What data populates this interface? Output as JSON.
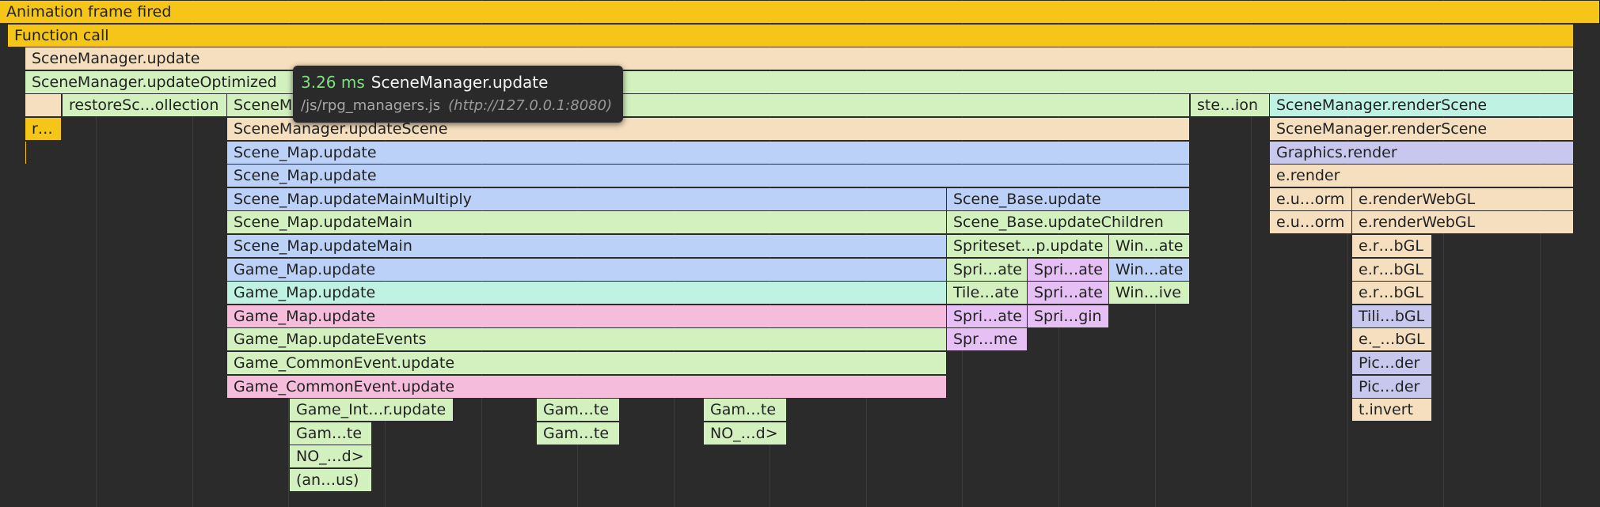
{
  "colors": {
    "yellow": "#f5c518",
    "peach": "#f5dfbf",
    "green": "#d3f0bf",
    "mint": "#c0f2e4",
    "blue": "#bcd1f8",
    "pink": "#f5bddb",
    "violet": "#e6bff5",
    "lavender": "#c8c8ef"
  },
  "tooltip": {
    "duration": "3.26 ms",
    "function": "SceneManager.update",
    "file": "/js/rpg_managers.js",
    "url": "(http://127.0.0.1:8080)"
  },
  "frames": [
    {
      "label": "Animation frame fired",
      "color": "yellow"
    },
    {
      "label": "Function call",
      "color": "yellow"
    },
    {
      "label": "SceneManager.update",
      "color": "peach"
    },
    {
      "label": "SceneManager.updateOptimized",
      "color": "green"
    },
    {
      "label": "",
      "color": "peach"
    },
    {
      "label": "restoreSc…ollection",
      "color": "green"
    },
    {
      "label": "SceneMa",
      "color": "green"
    },
    {
      "label": "ste…ion",
      "color": "green"
    },
    {
      "label": "SceneManager.renderScene",
      "color": "mint"
    },
    {
      "label": "r…",
      "color": "yellow"
    },
    {
      "label": "SceneManager.updateScene",
      "color": "peach"
    },
    {
      "label": "SceneManager.renderScene",
      "color": "peach"
    },
    {
      "label": "",
      "color": "yellow"
    },
    {
      "label": "Scene_Map.update",
      "color": "blue"
    },
    {
      "label": "Graphics.render",
      "color": "lavender"
    },
    {
      "label": "Scene_Map.update",
      "color": "blue"
    },
    {
      "label": "e.render",
      "color": "peach"
    },
    {
      "label": "Scene_Map.updateMainMultiply",
      "color": "blue"
    },
    {
      "label": "Scene_Base.update",
      "color": "blue"
    },
    {
      "label": "e.u…orm",
      "color": "peach"
    },
    {
      "label": "e.renderWebGL",
      "color": "peach"
    },
    {
      "label": "Scene_Map.updateMain",
      "color": "green"
    },
    {
      "label": "Scene_Base.updateChildren",
      "color": "green"
    },
    {
      "label": "e.u…orm",
      "color": "peach"
    },
    {
      "label": "e.renderWebGL",
      "color": "peach"
    },
    {
      "label": "Scene_Map.updateMain",
      "color": "blue"
    },
    {
      "label": "Spriteset…p.update",
      "color": "green"
    },
    {
      "label": "Win…ate",
      "color": "green"
    },
    {
      "label": "e.r…bGL",
      "color": "peach"
    },
    {
      "label": "Game_Map.update",
      "color": "blue"
    },
    {
      "label": "Spri…ate",
      "color": "green"
    },
    {
      "label": "Spri…ate",
      "color": "violet"
    },
    {
      "label": "Win…ate",
      "color": "blue"
    },
    {
      "label": "e.r…bGL",
      "color": "peach"
    },
    {
      "label": "Game_Map.update",
      "color": "mint"
    },
    {
      "label": "Tile…ate",
      "color": "green"
    },
    {
      "label": "Spri…ate",
      "color": "violet"
    },
    {
      "label": "Win…ive",
      "color": "green"
    },
    {
      "label": "e.r…bGL",
      "color": "peach"
    },
    {
      "label": "Game_Map.update",
      "color": "pink"
    },
    {
      "label": "Spri…ate",
      "color": "violet"
    },
    {
      "label": "Spri…gin",
      "color": "violet"
    },
    {
      "label": "Tili…bGL",
      "color": "lavender"
    },
    {
      "label": "Game_Map.updateEvents",
      "color": "green"
    },
    {
      "label": "Spr…me",
      "color": "violet"
    },
    {
      "label": "e._…bGL",
      "color": "peach"
    },
    {
      "label": "Game_CommonEvent.update",
      "color": "green"
    },
    {
      "label": "Pic…der",
      "color": "lavender"
    },
    {
      "label": "Game_CommonEvent.update",
      "color": "pink"
    },
    {
      "label": "Pic…der",
      "color": "lavender"
    },
    {
      "label": "Game_Int…r.update",
      "color": "green"
    },
    {
      "label": "Gam…te",
      "color": "green"
    },
    {
      "label": "Gam…te",
      "color": "green"
    },
    {
      "label": "t.invert",
      "color": "peach"
    },
    {
      "label": "Gam…te",
      "color": "green"
    },
    {
      "label": "Gam…te",
      "color": "green"
    },
    {
      "label": "NO_…d>",
      "color": "green"
    },
    {
      "label": "NO_…d>",
      "color": "green"
    },
    {
      "label": "(an…us)",
      "color": "green"
    }
  ]
}
